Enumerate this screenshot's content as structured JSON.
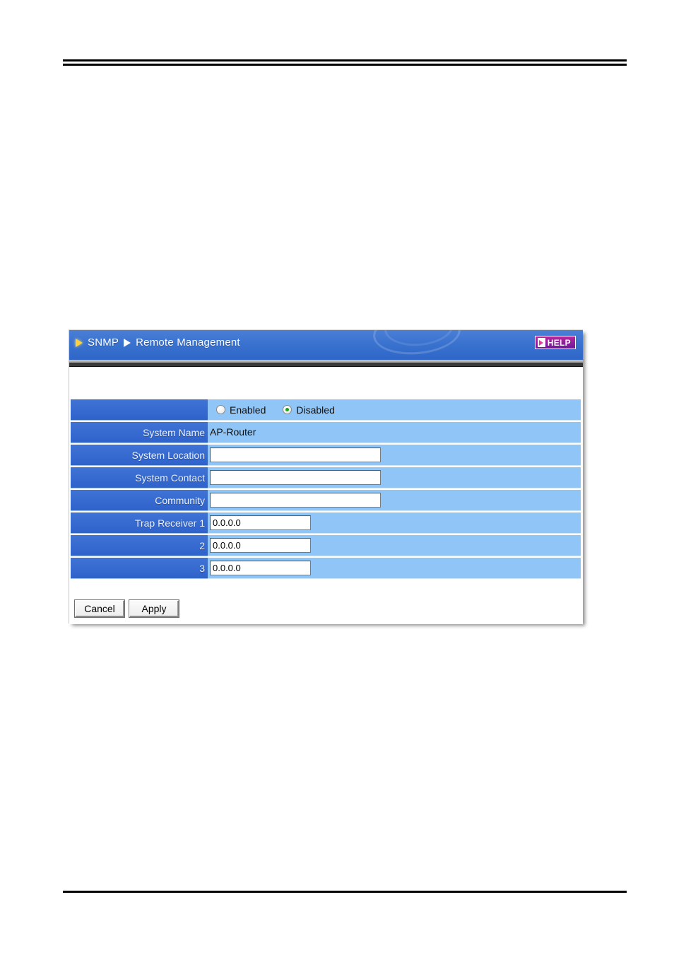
{
  "page": {
    "has_top_rule": true,
    "has_bottom_rule": true
  },
  "panel": {
    "header": {
      "crumb_primary": "SNMP",
      "crumb_secondary": "Remote Management",
      "help_label": "HELP"
    },
    "colors": {
      "header_blue": "#3a72cf",
      "label_blue": "#2f63cc",
      "value_blue": "#8fc6f7",
      "help_magenta": "#8c1f9e",
      "radio_green": "#18a418"
    },
    "rows": [
      {
        "label": "",
        "type": "radio",
        "options": [
          {
            "label": "Enabled",
            "selected": false
          },
          {
            "label": "Disabled",
            "selected": true
          }
        ]
      },
      {
        "label": "System Name",
        "type": "text",
        "value": "AP-Router"
      },
      {
        "label": "System Location",
        "type": "input",
        "size": "wide",
        "value": "",
        "placeholder": ""
      },
      {
        "label": "System Contact",
        "type": "input",
        "size": "wide",
        "value": "",
        "placeholder": ""
      },
      {
        "label": "Community",
        "type": "input",
        "size": "wide",
        "value": "",
        "placeholder": ""
      },
      {
        "label": "Trap Receiver 1",
        "type": "input",
        "size": "narrow",
        "value": "0.0.0.0",
        "placeholder": ""
      },
      {
        "label": "2",
        "type": "input",
        "size": "narrow",
        "value": "0.0.0.0",
        "placeholder": ""
      },
      {
        "label": "3",
        "type": "input",
        "size": "narrow",
        "value": "0.0.0.0",
        "placeholder": ""
      }
    ],
    "buttons": {
      "cancel_label": "Cancel",
      "apply_label": "Apply"
    }
  }
}
